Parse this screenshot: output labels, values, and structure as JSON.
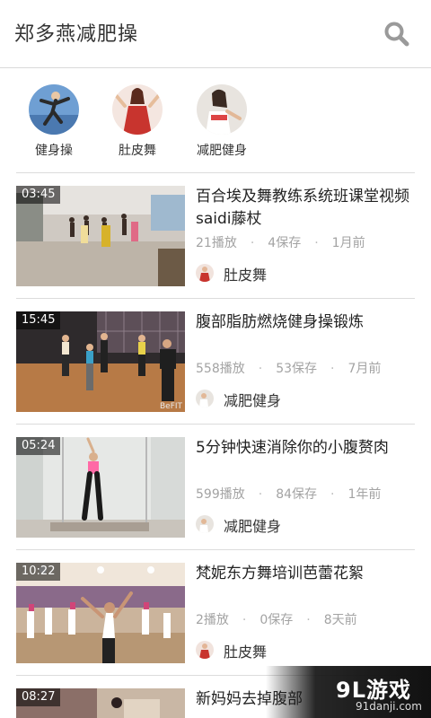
{
  "header": {
    "title": "郑多燕减肥操",
    "search_icon": "search-icon"
  },
  "categories": [
    {
      "label": "健身操",
      "color": "#5c8ec7"
    },
    {
      "label": "肚皮舞",
      "color": "#c8423d"
    },
    {
      "label": "减肥健身",
      "color": "#d9d2cc"
    }
  ],
  "videos": [
    {
      "duration": "03:45",
      "title": "百合埃及舞教练系统班课堂视频saidi藤杖",
      "plays": "21播放",
      "saves": "4保存",
      "time": "1月前",
      "author": "肚皮舞"
    },
    {
      "duration": "15:45",
      "title": "腹部脂肪燃烧健身操锻炼",
      "plays": "558播放",
      "saves": "53保存",
      "time": "7月前",
      "author": "减肥健身"
    },
    {
      "duration": "05:24",
      "title": "5分钟快速消除你的小腹赘肉",
      "plays": "599播放",
      "saves": "84保存",
      "time": "1年前",
      "author": "减肥健身"
    },
    {
      "duration": "10:22",
      "title": "梵妮东方舞培训芭蕾花絮",
      "plays": "2播放",
      "saves": "0保存",
      "time": "8天前",
      "author": "肚皮舞"
    },
    {
      "duration": "08:27",
      "title": "新妈妈去掉腹部"
    }
  ],
  "thumb_overlay_text": {
    "item1": "BeFIT"
  },
  "watermark": {
    "title": "9L游戏",
    "url": "91danji.com"
  }
}
